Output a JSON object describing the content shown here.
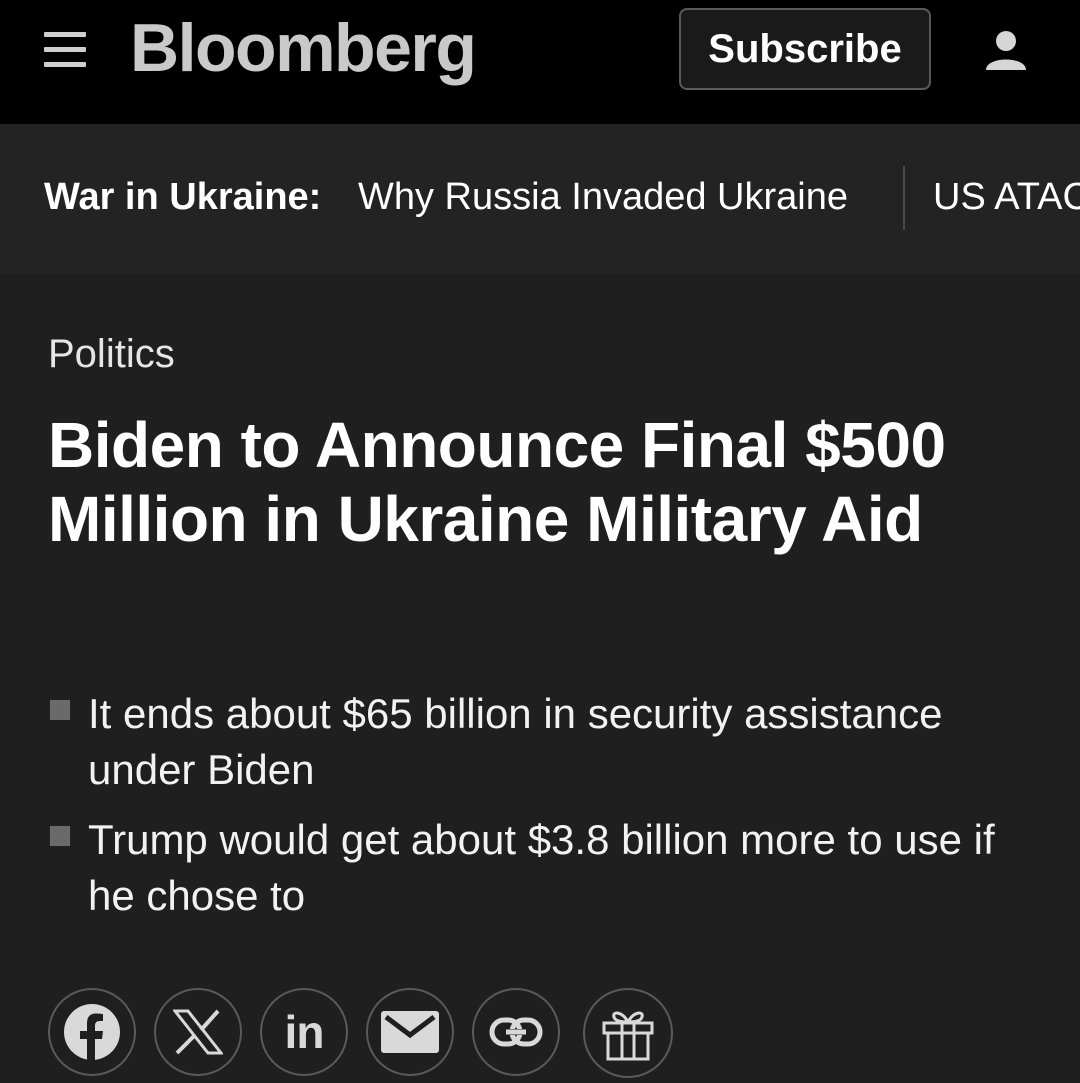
{
  "header": {
    "logo": "Bloomberg",
    "subscribe_label": "Subscribe"
  },
  "ticker": {
    "label": "War in Ukraine:",
    "link1": "Why Russia Invaded Ukraine",
    "link2": "US ATAC"
  },
  "article": {
    "category": "Politics",
    "headline": "Biden to Announce Final $500 Million in Ukraine Military Aid",
    "bullets": [
      "It ends about $65 billion in security assistance under Biden",
      "Trump would get about $3.8 billion more to use if he chose to"
    ]
  },
  "share": {
    "icons": [
      "facebook-icon",
      "x-icon",
      "linkedin-icon",
      "email-icon",
      "link-icon",
      "gift-icon"
    ],
    "linkedin_text": "in"
  }
}
